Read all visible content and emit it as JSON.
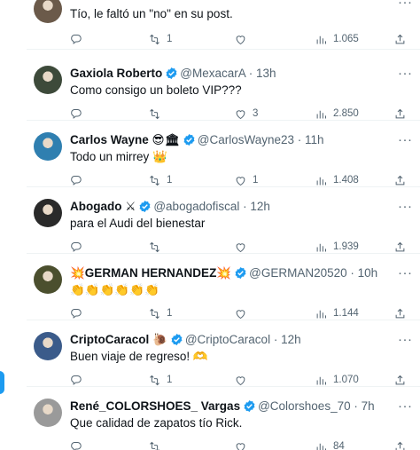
{
  "tweets": [
    {
      "name": "",
      "handle": "",
      "time": "",
      "text": "Tío,  le faltó un \"no\" en su post.",
      "replies": "",
      "retweets": "1",
      "likes": "",
      "views": "1.065",
      "avatar_color": "#6b5a4a"
    },
    {
      "name": "Gaxiola Roberto",
      "handle": "@MexacarA",
      "time": "13h",
      "text": "Como consigo un boleto VIP???",
      "replies": "",
      "retweets": "",
      "likes": "3",
      "views": "2.850",
      "avatar_color": "#3d4a3a"
    },
    {
      "name": "Carlos Wayne 😎🏛",
      "handle": "@CarlosWayne23",
      "time": "11h",
      "text": "Todo un mirrey 👑",
      "replies": "",
      "retweets": "1",
      "likes": "1",
      "views": "1.408",
      "avatar_color": "#2f7fb0"
    },
    {
      "name": "Abogado ⚔",
      "handle": "@abogadofiscal",
      "time": "12h",
      "text": "para el Audi del bienestar",
      "replies": "",
      "retweets": "",
      "likes": "",
      "views": "1.939",
      "avatar_color": "#2a2a2a"
    },
    {
      "name": "💥GERMAN HERNANDEZ💥",
      "handle": "@GERMAN20520",
      "time": "10h",
      "text": "👏👏👏👏👏👏",
      "replies": "",
      "retweets": "1",
      "likes": "",
      "views": "1.144",
      "avatar_color": "#4b4f2e"
    },
    {
      "name": "CriptoCaracol 🐌",
      "handle": "@CriptoCaracol",
      "time": "12h",
      "text": "Buen viaje de regreso! 🫶",
      "replies": "",
      "retweets": "1",
      "likes": "",
      "views": "1.070",
      "avatar_color": "#3b5b8a"
    },
    {
      "name": "René_COLORSHOES_ Vargas",
      "handle": "@Colorshoes_70",
      "time": "7h",
      "text": "Que calidad de zapatos tío Rick.",
      "replies": "",
      "retweets": "",
      "likes": "",
      "views": "84",
      "avatar_color": "#9a9a9a"
    }
  ],
  "colors": {
    "verified": "#1d9bf0",
    "muted": "#536471",
    "text": "#0f1419",
    "divider": "#eff3f4"
  },
  "icons": [
    "reply-icon",
    "retweet-icon",
    "like-icon",
    "views-icon",
    "share-icon",
    "verified-badge-icon",
    "more-icon"
  ]
}
